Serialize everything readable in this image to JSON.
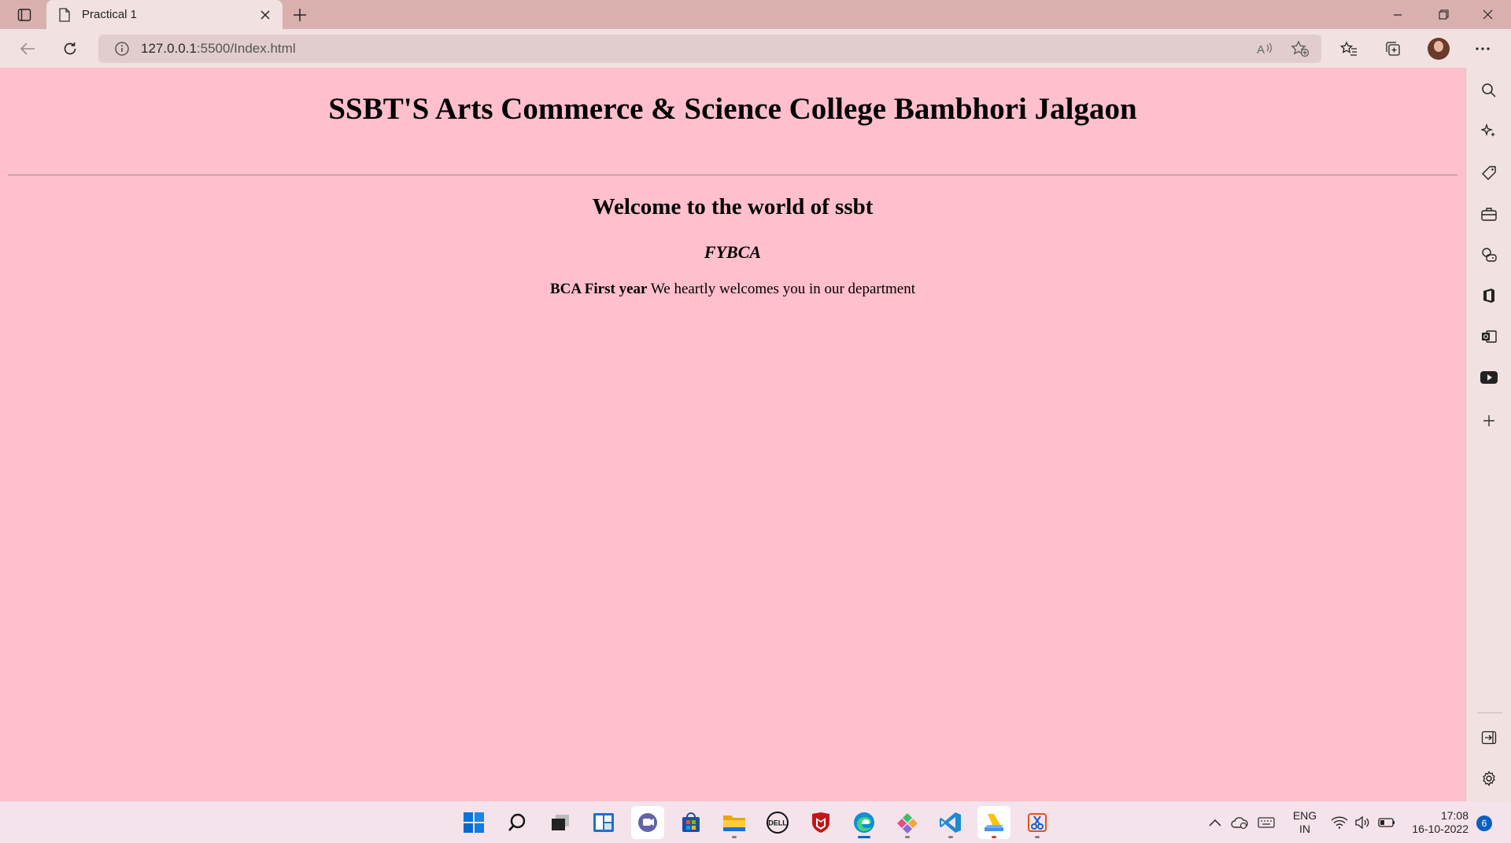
{
  "browser": {
    "tab_title": "Practical 1",
    "url_host": "127.0.0.1",
    "url_path": ":5500/Index.html"
  },
  "page": {
    "heading": "SSBT'S Arts Commerce & Science College Bambhori Jalgaon",
    "welcome": "Welcome to the world of ssbt",
    "class_name": "FYBCA",
    "bold_text": "BCA First year",
    "message": " We heartly welcomes you in our department"
  },
  "taskbar": {
    "lang_line1": "ENG",
    "lang_line2": "IN",
    "time": "17:08",
    "date": "16-10-2022",
    "notifications": "6"
  },
  "colors": {
    "page_background": "#ffbfcc",
    "title_bar": "#d8b0ae",
    "toolbar": "#f1e1e1"
  }
}
